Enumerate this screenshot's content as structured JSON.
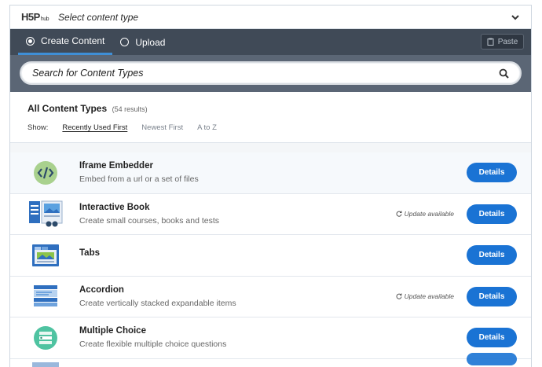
{
  "header": {
    "logo_main": "H5P",
    "logo_sub": "hub",
    "title": "Select content type"
  },
  "tabs": [
    {
      "label": "Create Content",
      "selected": true
    },
    {
      "label": "Upload",
      "selected": false
    }
  ],
  "paste_label": "Paste",
  "search": {
    "placeholder": "Search for Content Types"
  },
  "results": {
    "title": "All Content Types",
    "count": "(54 results)",
    "show_label": "Show:",
    "sort_options": [
      "Recently Used First",
      "Newest First",
      "A to Z"
    ]
  },
  "items": [
    {
      "name": "Iframe Embedder",
      "desc": "Embed from a url or a set of files",
      "update": "",
      "details": "Details",
      "icon": "iframe-embedder-icon"
    },
    {
      "name": "Interactive Book",
      "desc": "Create small courses, books and tests",
      "update": "Update available",
      "details": "Details",
      "icon": "interactive-book-icon"
    },
    {
      "name": "Tabs",
      "desc": "",
      "update": "",
      "details": "Details",
      "icon": "tabs-icon"
    },
    {
      "name": "Accordion",
      "desc": "Create vertically stacked expandable items",
      "update": "Update available",
      "details": "Details",
      "icon": "accordion-icon"
    },
    {
      "name": "Multiple Choice",
      "desc": "Create flexible multiple choice questions",
      "update": "",
      "details": "Details",
      "icon": "multiple-choice-icon"
    }
  ],
  "colors": {
    "nav_bg": "#404a57",
    "search_bg": "#5b6675",
    "accent": "#1a73d4"
  }
}
